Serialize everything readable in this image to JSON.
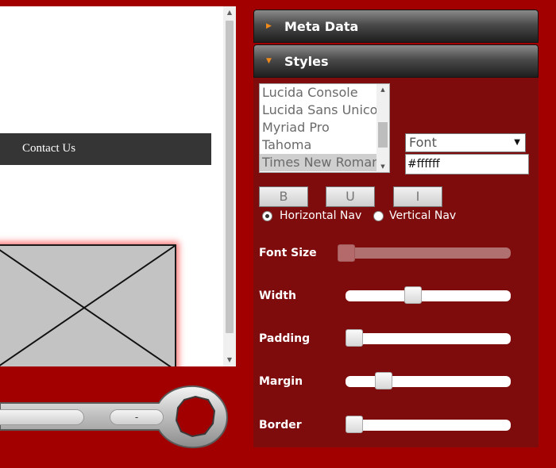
{
  "preview": {
    "nav_item": "Contact Us"
  },
  "wrench_toolbar": {
    "field_1_value": "",
    "field_2_value": "-"
  },
  "panel": {
    "sections": [
      {
        "label": "Meta Data",
        "expanded": false
      },
      {
        "label": "Styles",
        "expanded": true
      }
    ],
    "font_list": {
      "options": [
        "Lucida Console",
        "Lucida Sans Unicode",
        "Myriad Pro",
        "Tahoma",
        "Times New Roman"
      ],
      "selected": "Times New Roman"
    },
    "font_select": {
      "value": "Font"
    },
    "color_input": {
      "value": "#ffffff"
    },
    "format_buttons": {
      "bold": "B",
      "underline": "U",
      "italic": "I"
    },
    "nav_orientation": {
      "horizontal_label": "Horizontal Nav",
      "vertical_label": "Vertical Nav",
      "selected": "horizontal"
    },
    "sliders": [
      {
        "label": "Font Size",
        "value": 0.0,
        "disabled": true
      },
      {
        "label": "Width",
        "value": 0.4,
        "disabled": false
      },
      {
        "label": "Padding",
        "value": 0.0,
        "disabled": false
      },
      {
        "label": "Margin",
        "value": 0.2,
        "disabled": false
      },
      {
        "label": "Border",
        "value": 0.0,
        "disabled": false
      }
    ]
  },
  "colors": {
    "background": "#a20000",
    "panel_body": "#7e0c0c",
    "accent_triangle": "#f08a1a",
    "nav_bar": "#353535"
  }
}
